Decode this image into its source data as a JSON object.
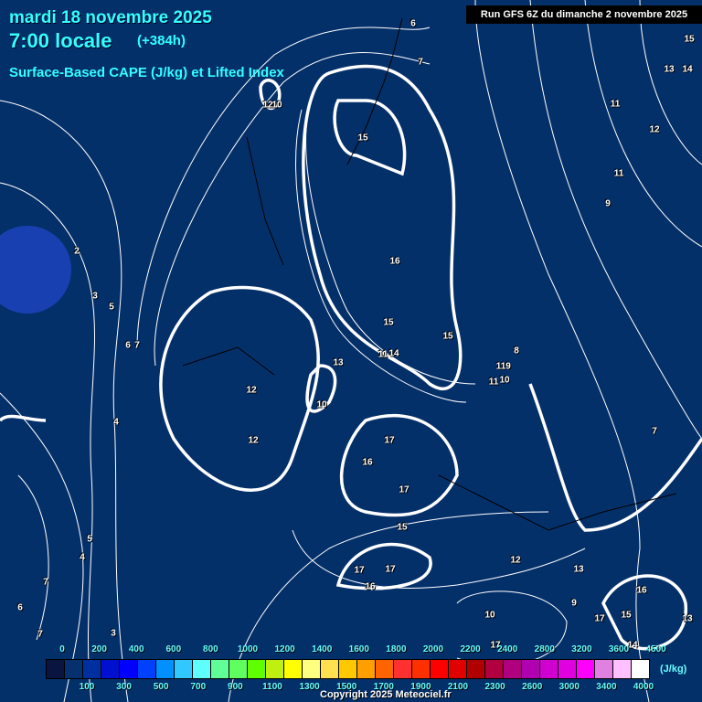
{
  "header": {
    "date": "mardi 18 novembre 2025",
    "time": "7:00 locale",
    "lead": "(+384h)",
    "title": "Surface-Based CAPE (J/kg) et Lifted Index",
    "run": "Run GFS 6Z du dimanche 2 novembre 2025"
  },
  "contour_labels": [
    "6",
    "7",
    "15",
    "13",
    "14",
    "12",
    "11",
    "11",
    "12",
    "10",
    "9",
    "15",
    "16",
    "15",
    "15",
    "14",
    "11",
    "13",
    "11",
    "10",
    "11",
    "9",
    "8",
    "10",
    "12",
    "17",
    "16",
    "17",
    "15",
    "17",
    "17",
    "16",
    "12",
    "12",
    "13",
    "9",
    "10",
    "17",
    "16",
    "15",
    "17",
    "14",
    "13",
    "7",
    "2",
    "3",
    "5",
    "6",
    "7",
    "4",
    "5",
    "4",
    "7",
    "6",
    "7",
    "3"
  ],
  "legend": {
    "unit": "(J/kg)",
    "top_ticks": [
      "0",
      "200",
      "400",
      "600",
      "800",
      "1000",
      "1200",
      "1400",
      "1600",
      "1800",
      "2000",
      "2200",
      "2400",
      "2800",
      "3200",
      "3600",
      "4500"
    ],
    "bottom_ticks": [
      "100",
      "300",
      "500",
      "700",
      "900",
      "1100",
      "1300",
      "1500",
      "1700",
      "1900",
      "2100",
      "2300",
      "2600",
      "3000",
      "3400",
      "4000"
    ],
    "colors": [
      "#0a1440",
      "#06306e",
      "#0030a0",
      "#0010d0",
      "#0000ff",
      "#0040ff",
      "#0090ff",
      "#30c8ff",
      "#60ffff",
      "#60ff98",
      "#60ff60",
      "#60ff00",
      "#c0f010",
      "#ffff00",
      "#ffff80",
      "#ffe050",
      "#ffc800",
      "#ffa000",
      "#ff6400",
      "#ff3030",
      "#ff3000",
      "#ff0000",
      "#e00000",
      "#b00000",
      "#b00040",
      "#b00080",
      "#b000b0",
      "#d000d0",
      "#e000e0",
      "#ff00ff",
      "#e080e0",
      "#ffc0ff",
      "#ffffff"
    ]
  },
  "copyright": "Copyright 2025 Meteociel.fr"
}
